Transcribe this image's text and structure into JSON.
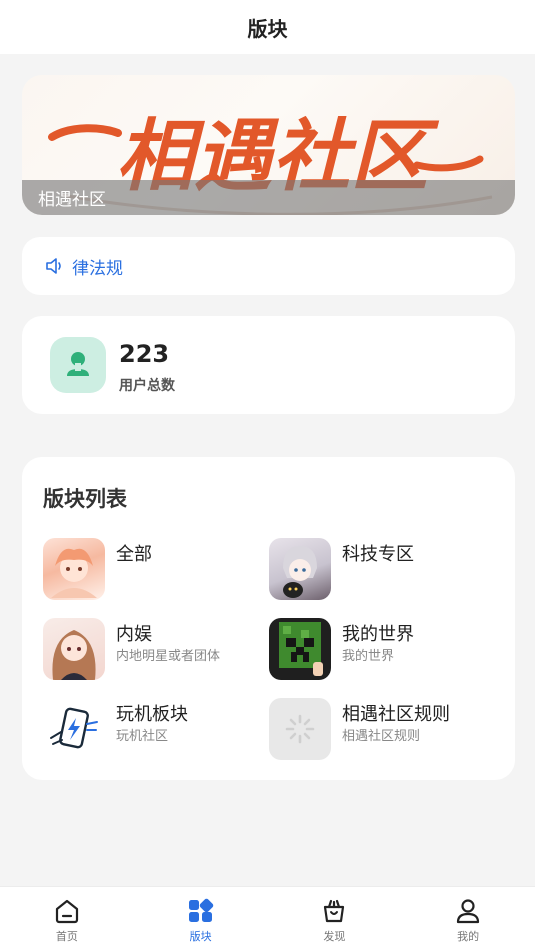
{
  "header": {
    "title": "版块"
  },
  "banner": {
    "logo_text": "相遇社区",
    "caption": "相遇社区"
  },
  "notice": {
    "text": "律法规"
  },
  "stats": {
    "user_total": "223",
    "user_total_label": "用户总数"
  },
  "boards": {
    "title": "版块列表",
    "items": [
      {
        "name": "全部",
        "desc": ""
      },
      {
        "name": "科技专区",
        "desc": ""
      },
      {
        "name": "内娱",
        "desc": "内地明星或者团体"
      },
      {
        "name": "我的世界",
        "desc": "我的世界"
      },
      {
        "name": "玩机板块",
        "desc": "玩机社区"
      },
      {
        "name": "相遇社区规则",
        "desc": "相遇社区规则"
      }
    ]
  },
  "tabbar": {
    "items": [
      {
        "label": "首页",
        "icon": "home-icon"
      },
      {
        "label": "版块",
        "icon": "blocks-icon",
        "active": true
      },
      {
        "label": "发现",
        "icon": "discover-bag-icon"
      },
      {
        "label": "我的",
        "icon": "user-icon"
      }
    ]
  },
  "colors": {
    "accent": "#2a6fe0",
    "stats_icon_bg": "#cdeee2",
    "stats_icon": "#2fb07a",
    "logo": "#e2582a"
  }
}
